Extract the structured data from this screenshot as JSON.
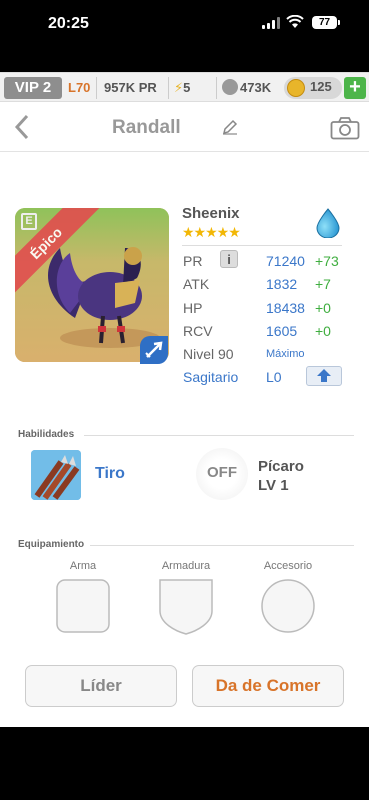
{
  "status_bar": {
    "time": "20:25",
    "battery": "77"
  },
  "resources": {
    "vip": "VIP 2",
    "level": "L70",
    "power": "957K",
    "power_unit": "PR",
    "energy": "5",
    "food": "473K",
    "coins": "125"
  },
  "header": {
    "title": "Randall"
  },
  "creature": {
    "rarity": "Épico",
    "badge_letter": "E",
    "name": "Sheenix",
    "stars": "★★★★★",
    "stats": [
      {
        "label": "PR",
        "value": "71240",
        "delta": "+73"
      },
      {
        "label": "ATK",
        "value": "1832",
        "delta": "+7"
      },
      {
        "label": "HP",
        "value": "18438",
        "delta": "+0"
      },
      {
        "label": "RCV",
        "value": "1605",
        "delta": "+0"
      }
    ],
    "level_label": "Nivel 90",
    "level_value": "Máximo",
    "sign": "Sagitario",
    "sign_level": "L0"
  },
  "skills": {
    "title": "Habilidades",
    "skill1": "Tiro",
    "toggle": "OFF",
    "skill2_name": "Pícaro",
    "skill2_level": "LV 1"
  },
  "equipment": {
    "title": "Equipamiento",
    "slots": [
      "Arma",
      "Armadura",
      "Accesorio"
    ]
  },
  "buttons": {
    "leader": "Líder",
    "feed": "Da de Comer"
  },
  "colors": {
    "accent_blue": "#3b77c9",
    "green": "#3fae3f",
    "orange": "#d8742a",
    "epic_red": "#e0504f"
  }
}
